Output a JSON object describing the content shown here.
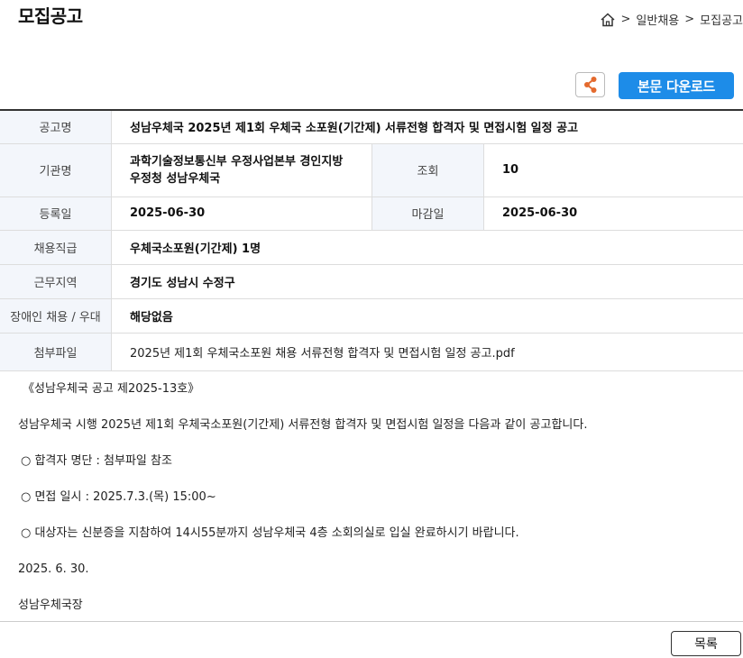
{
  "page": {
    "title": "모집공고"
  },
  "breadcrumb": {
    "home_icon": "home-icon",
    "sep1": ">",
    "item1": "일반채용",
    "sep2": ">",
    "item2": "모집공고"
  },
  "toolbar": {
    "share_icon": "share-icon",
    "download_label": "본문 다운로드"
  },
  "info": {
    "title_label": "공고명",
    "title_value": "성남우체국 2025년 제1회 우체국 소포원(기간제) 서류전형 합격자 및 면접시험 일정 공고",
    "org_label": "기관명",
    "org_value_line1": "과학기술정보통신부 우정사업본부 경인지방",
    "org_value_line2": "우정청 성남우체국",
    "views_label": "조회",
    "views_value": "10",
    "reg_label": "등록일",
    "reg_value": "2025-06-30",
    "deadline_label": "마감일",
    "deadline_value": "2025-06-30",
    "grade_label": "채용직급",
    "grade_value": "우체국소포원(기간제) 1명",
    "area_label": "근무지역",
    "area_value": "경기도 성남시 수정구",
    "disability_label": "장애인 채용 / 우대",
    "disability_value": "해당없음",
    "attach_label": "첨부파일",
    "attach_value": "2025년 제1회 우체국소포원 채용 서류전형 합격자 및 면접시험 일정 공고.pdf"
  },
  "body": {
    "line1": "《성남우체국 공고 제2025-13호》",
    "line2": "성남우체국 시행 2025년 제1회 우체국소포원(기간제) 서류전형 합격자 및 면접시험 일정을 다음과 같이 공고합니다.",
    "line3": "○ 합격자 명단 : 첨부파일 참조",
    "line4": "○  면접 일시 : 2025.7.3.(목) 15:00~",
    "line5": "○ 대상자는 신분증을 지참하여  14시55분까지 성남우체국 4층 소회의실로 입실 완료하시기 바랍니다.",
    "line6": "2025. 6. 30.",
    "line7": "성남우체국장"
  },
  "footer": {
    "list_button": "목록"
  }
}
